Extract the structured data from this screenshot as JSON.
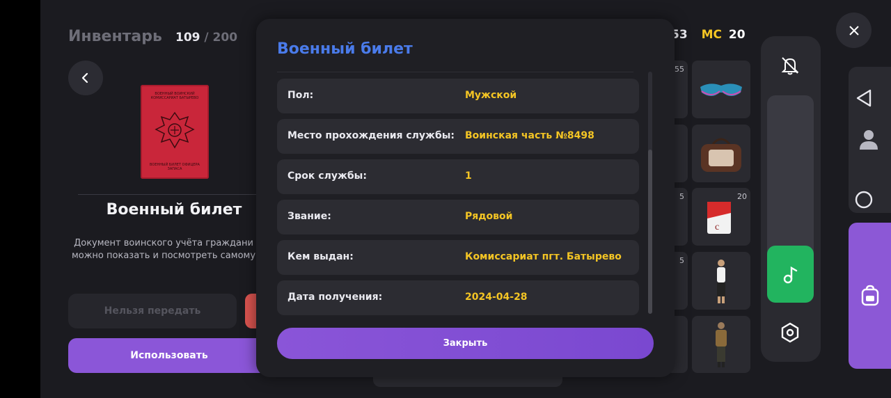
{
  "inventory": {
    "title": "Инвентарь",
    "count_current": "109",
    "count_sep": " / ",
    "count_max": "200"
  },
  "item": {
    "name": "Военный билет",
    "description_line1": "Документ воинского учёта граждани",
    "description_line2": "можно показать и посмотреть самому",
    "passport_top_text": "ВОЕННЫЙ ВОИНСКИЙ КОМИССАРИАТ БАТЫРЕВО",
    "passport_bottom_text": "ВОЕННЫЙ БИЛЕТ ОФИЦЕРА ЗАПАСА"
  },
  "buttons": {
    "no_transfer": "Нельзя передать",
    "use": "Использовать",
    "close": "Закрыть"
  },
  "stats": {
    "prev_value": "53",
    "mc_label": "MC",
    "mc_value": "20"
  },
  "slots": [
    {
      "qty": "55"
    },
    {
      "qty": ""
    },
    {
      "qty": "5"
    },
    {
      "qty": "20"
    },
    {
      "qty": "5"
    }
  ],
  "modal": {
    "title": "Военный билет",
    "rows": [
      {
        "label": "Пол:",
        "value": "Мужской"
      },
      {
        "label": "Место прохождения службы:",
        "value": "Воинская часть №8498"
      },
      {
        "label": "Срок службы:",
        "value": "1"
      },
      {
        "label": "Звание:",
        "value": "Рядовой"
      },
      {
        "label": "Кем выдан:",
        "value": "Комиссариат пгт. Батырево"
      },
      {
        "label": "Дата получения:",
        "value": "2024-04-28"
      }
    ]
  },
  "colors": {
    "accent_purple": "#8b56d8",
    "title_blue": "#4a7bea",
    "value_yellow": "#f4c524",
    "music_green": "#22b45f"
  },
  "icons": [
    "back-arrow-icon",
    "bell-off-icon",
    "music-note-icon",
    "hexagon-settings-icon",
    "close-icon",
    "triangle-back-icon",
    "person-icon",
    "circle-home-icon",
    "backpack-icon"
  ]
}
